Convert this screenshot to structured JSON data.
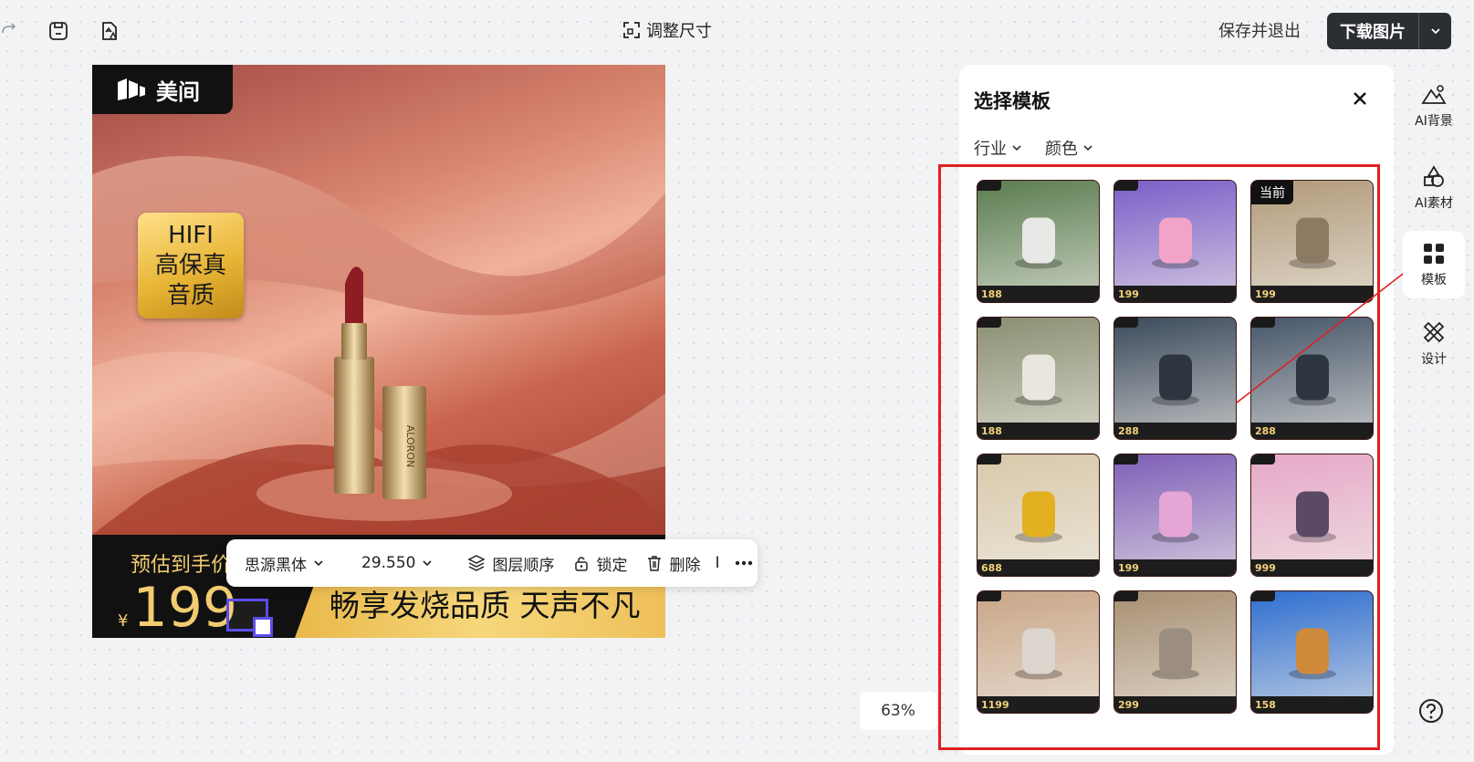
{
  "toolbar": {
    "resize_label": "调整尺寸",
    "save_exit_label": "保存并退出",
    "download_label": "下载图片"
  },
  "poster": {
    "brand": "美间",
    "badge_lines": [
      "HIFI",
      "高保真",
      "音质"
    ],
    "estimate_label": "预估到手价",
    "currency": "¥",
    "price": "199",
    "slogan": "畅享发烧品质 天声不凡",
    "product_text": "ALORON"
  },
  "float_toolbar": {
    "font": "思源黑体",
    "font_size": "29.550",
    "layer_order": "图层顺序",
    "lock": "锁定",
    "delete": "删除",
    "separator": "I"
  },
  "zoom": "63%",
  "panel": {
    "title": "选择模板",
    "filters": [
      "行业",
      "颜色"
    ],
    "current_tag": "当前",
    "templates": [
      {
        "price": "188",
        "bg": "#5a7d50",
        "obj": "#e8e8e6"
      },
      {
        "price": "199",
        "bg": "#7b5fc9",
        "obj": "#f4a3c8"
      },
      {
        "price": "199",
        "bg": "#b19a7a",
        "obj": "#8c7a62",
        "current": true
      },
      {
        "price": "188",
        "bg": "#8a8f72",
        "obj": "#e9e6de"
      },
      {
        "price": "288",
        "bg": "#3b4a5c",
        "obj": "#2d3540"
      },
      {
        "price": "288",
        "bg": "#46566a",
        "obj": "#2d3540"
      },
      {
        "price": "688",
        "bg": "#d8c9aa",
        "obj": "#e2b021"
      },
      {
        "price": "199",
        "bg": "#7e5fb8",
        "obj": "#e6a6d5"
      },
      {
        "price": "999",
        "bg": "#e6a8c8",
        "obj": "#5a4a66"
      },
      {
        "price": "1199",
        "bg": "#c9a688",
        "obj": "#dcd6ce"
      },
      {
        "price": "299",
        "bg": "#a88f72",
        "obj": "#9b8e80"
      },
      {
        "price": "158",
        "bg": "#2f6fd0",
        "obj": "#d08a3c"
      }
    ]
  },
  "rail": {
    "items": [
      "AI背景",
      "AI素材",
      "模板",
      "设计"
    ]
  },
  "colors": {
    "accent": "#5b4de8",
    "highlight": "#e02020",
    "gold": "#f1cc70"
  }
}
